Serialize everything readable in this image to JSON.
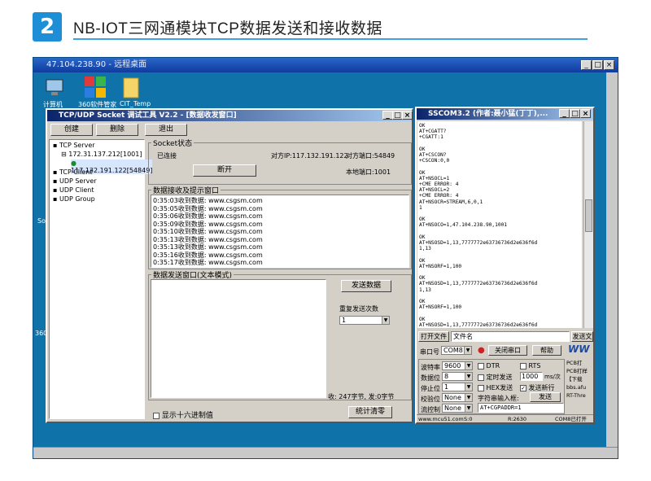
{
  "header": {
    "step_number": "2",
    "title": "NB-IOT三网通模块TCP数据发送和接收数据"
  },
  "remote": {
    "title": "47.104.238.90 - 远程桌面",
    "icons": [
      {
        "label": "计算机"
      },
      {
        "label": "360软件管家"
      },
      {
        "label": "CIT_Temp"
      }
    ],
    "side_labels": [
      "So",
      "360"
    ]
  },
  "tcp": {
    "title": "TCP/UDP Socket 调试工具 V2.2 - [数据收发窗口]",
    "btn_create": "创建",
    "btn_delete": "删除",
    "btn_exit": "退出",
    "tree": [
      "TCP Server",
      "172.31.137.212[1001]",
      "117.132.191.122[54849]",
      "TCP Client",
      "UDP Server",
      "UDP Client",
      "UDP Group"
    ],
    "socket_group": "Socket状态",
    "status": "已连接",
    "peer_ip": "对方IP:117.132.191.122",
    "peer_port": "对方端口:54849",
    "local_port": "本地端口:1001",
    "disconnect": "断开",
    "recv_group": "数据接收及提示窗口",
    "recv_lines": [
      "0:35:03收到数据: www.csgsm.com",
      "0:35:05收到数据: www.csgsm.com",
      "0:35:06收到数据: www.csgsm.com",
      "0:35:09收到数据: www.csgsm.com",
      "0:35:10收到数据: www.csgsm.com",
      "0:35:13收到数据: www.csgsm.com",
      "0:35:13收到数据: www.csgsm.com",
      "0:35:16收到数据: www.csgsm.com",
      "0:35:17收到数据: www.csgsm.com"
    ],
    "send_group": "数据发送窗口(文本模式)",
    "send_btn": "发送数据",
    "repeat_label": "重复发送次数",
    "repeat_value": "1",
    "stats": "收: 247字节, 发:0字节",
    "hex_label": "显示十六进制值",
    "clear_btn": "统计清零"
  },
  "sscom": {
    "title": "SSCOM3.2 (作者:聂小猛(丁丁),...",
    "terminal": [
      "OK",
      "AT+CGATT?",
      "+CGATT:1",
      "",
      "OK",
      "AT+CSCON?",
      "+CSCON:0,0",
      "",
      "OK",
      "AT+NSOCL=1",
      "+CME ERROR: 4",
      "AT+NSOCL=2",
      "+CME ERROR: 4",
      "AT+NSOCR=STREAM,6,0,1",
      "1",
      "",
      "OK",
      "AT+NSOCO=1,47.104.238.90,1001",
      "",
      "OK",
      "AT+NSOSD=1,13,7777772e63736736d2e636f6d",
      "1,13",
      "",
      "OK",
      "AT+NSORF=1,100",
      "",
      "OK",
      "AT+NSOSD=1,13,7777772e63736736d2e636f6d",
      "1,13",
      "",
      "OK",
      "AT+NSORF=1,100",
      "",
      "OK",
      "AT+NSOSD=1,13,7777772e63736736d2e636f6d"
    ],
    "open_file": "打开文件",
    "file_name": "文件名",
    "send_file": "发送文",
    "port_label": "串口号",
    "port_value": "COM8",
    "close_port": "关闭串口",
    "help": "帮助",
    "baud_label": "波特率",
    "baud": "9600",
    "data_label": "数据位",
    "data": "8",
    "stop_label": "停止位",
    "stop": "1",
    "parity_label": "校验位",
    "parity": "None",
    "flow_label": "流控制",
    "flow": "None",
    "dtr": "DTR",
    "rts": "RTS",
    "timed": "定时发送",
    "interval": "1000",
    "interval_unit": "ms/次",
    "hex_send": "HEX发送",
    "newline": "发送新行",
    "input_label": "字符串输入框:",
    "send": "发送",
    "input_value": "AT+CGPADDR=1",
    "ad": [
      "PCB打",
      "PCB打样",
      "【下载",
      "bbs.afu",
      "RT-Thre"
    ],
    "status_url": "www.mcu51.com",
    "status_s": "S:0",
    "status_r": "R:2630",
    "status_port": "COM8已打开"
  }
}
